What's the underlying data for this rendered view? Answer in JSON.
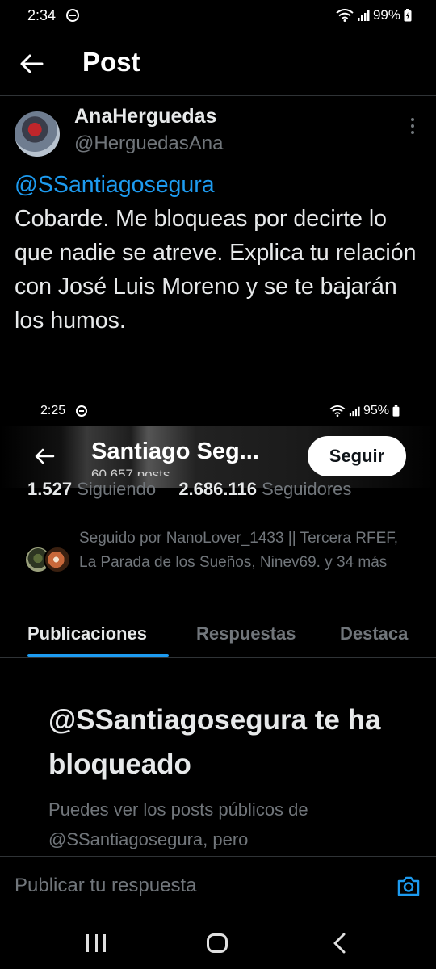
{
  "status_bar": {
    "time": "2:34",
    "battery": "99%"
  },
  "header": {
    "title": "Post"
  },
  "post": {
    "author_name": "AnaHerguedas",
    "author_handle": "@HerguedasAna",
    "mention": "@SSantiagosegura",
    "text": "Cobarde. Me bloqueas por decirte lo que nadie se atreve. Explica tu relación con José Luis Moreno y se te bajarán los humos."
  },
  "embedded_screenshot": {
    "status_bar": {
      "time": "2:25",
      "battery": "95%"
    },
    "profile_name": "Santiago Seg...",
    "posts_count": "60.657 posts",
    "follow_label": "Seguir",
    "following_count": "1.527",
    "following_label": "Siguiendo",
    "followers_count": "2.686.116",
    "followers_label": "Seguidores",
    "followed_by": "Seguido por NanoLover_1433 || Tercera RFEF, La Parada de los Sueños, Ninev69. y 34 más",
    "tabs": [
      "Publicaciones",
      "Respuestas",
      "Destaca"
    ],
    "blocked_title": "@SSantiagosegura te ha bloqueado",
    "blocked_subtitle": "Puedes ver los posts públicos de @SSantiagosegura, pero"
  },
  "reply": {
    "placeholder": "Publicar tu respuesta"
  },
  "colors": {
    "accent": "#1d9bf0",
    "background": "#000000",
    "secondary_text": "#71767b"
  }
}
